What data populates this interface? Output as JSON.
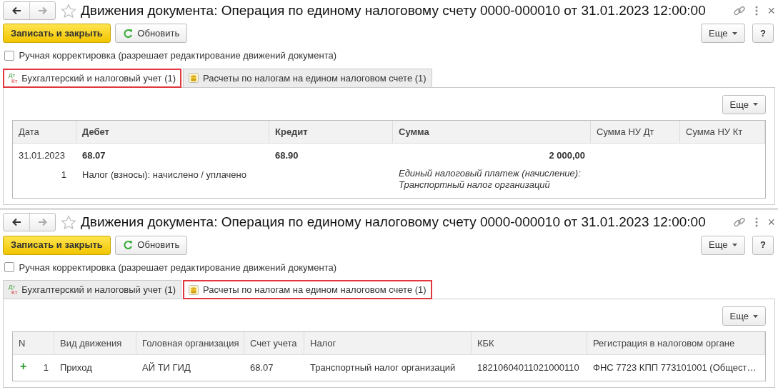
{
  "windows": [
    {
      "title": "Движения документа: Операция по единому налоговому счету 0000-000010 от 31.01.2023 12:00:00",
      "close": "×",
      "save_button": "Записать и закрыть",
      "refresh_button": "Обновить",
      "more_button": "Еще",
      "help_button": "?",
      "manual": {
        "label": "Ручная корректировка (разрешает редактирование движений документа)",
        "checked": false
      },
      "tabs": [
        {
          "label": "Бухгалтерский и налоговый учет (1)",
          "kind": "accounting",
          "icon_lines": [
            "Дт",
            "Кт"
          ],
          "selected": true,
          "highlighted": true
        },
        {
          "label": "Расчеты по налогам на едином налоговом счете (1)",
          "kind": "settlement",
          "selected": false,
          "highlighted": false
        }
      ],
      "panel_more_button": "Еще",
      "table": {
        "kind": "accounting",
        "columns": [
          "Дата",
          "Дебет",
          "Кредит",
          "Сумма",
          "Сумма НУ Дт",
          "Сумма НУ Кт"
        ],
        "rows": [
          {
            "date": "31.01.2023",
            "debit": "68.07",
            "credit": "68.90",
            "amount": "2 000,00",
            "number": "1",
            "debit_sub": "Налог (взносы): начислено / уплачено",
            "content": [
              "Единый налоговый платеж (начисление):",
              "Транспортный налог организаций"
            ]
          }
        ]
      }
    },
    {
      "title": "Движения документа: Операция по единому налоговому счету 0000-000010 от 31.01.2023 12:00:00",
      "close": "×",
      "save_button": "Записать и закрыть",
      "refresh_button": "Обновить",
      "more_button": "Еще",
      "help_button": "?",
      "manual": {
        "label": "Ручная корректировка (разрешает редактирование движений документа)",
        "checked": false
      },
      "tabs": [
        {
          "label": "Бухгалтерский и налоговый учет (1)",
          "kind": "accounting",
          "icon_lines": [
            "Дт",
            "Кт"
          ],
          "selected": false,
          "highlighted": false
        },
        {
          "label": "Расчеты по налогам на едином налоговом счете (1)",
          "kind": "settlement",
          "selected": true,
          "highlighted": true
        }
      ],
      "panel_more_button": "Еще",
      "table": {
        "kind": "register",
        "columns": [
          "N",
          "Вид движения",
          "Головная организация",
          "Счет учета",
          "Налог",
          "КБК",
          "Регистрация в налоговом органе"
        ],
        "rows": [
          {
            "movement": "+",
            "cells": [
              "1",
              "Приход",
              "АЙ ТИ ГИД",
              "68.07",
              "Транспортный налог организаций",
              "18210604011021000110",
              "ФНС 7723 КПП 773101001 (Общест…"
            ]
          }
        ]
      }
    }
  ]
}
